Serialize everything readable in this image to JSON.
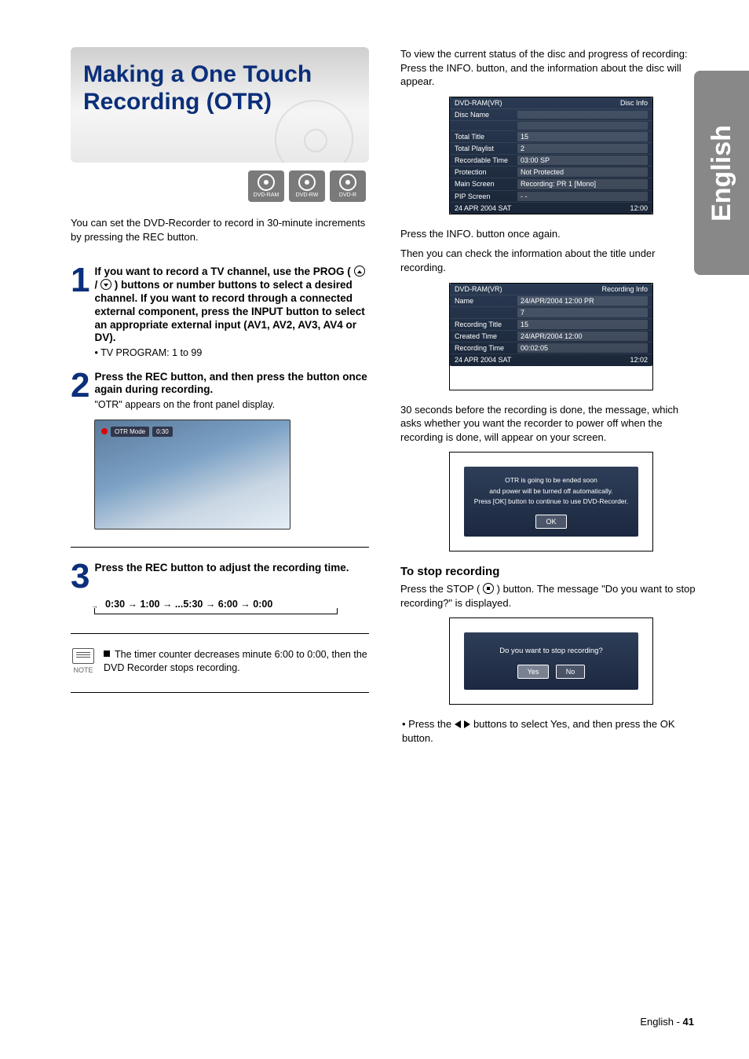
{
  "sideTab": "English",
  "title": "Making a One Touch Recording (OTR)",
  "badges": [
    "DVD-RAM",
    "DVD-RW",
    "DVD-R"
  ],
  "intro": "You can set the DVD-Recorder to record in 30-minute increments by pressing the REC button.",
  "steps": {
    "s1": {
      "num": "1",
      "body": "If you want to record a TV channel, use the PROG (        ) buttons or number buttons to select a desired channel. If you want to record through a connected external component, press the INPUT button to select an appropriate external input (AV1, AV2, AV3, AV4 or DV).",
      "sub": "• TV PROGRAM: 1 to 99"
    },
    "s2": {
      "num": "2",
      "body": "Press the REC button, and then press the button once again during recording.",
      "sub": "\"OTR\" appears on the front panel display."
    },
    "s3": {
      "num": "3",
      "body": "Press the REC button to adjust the recording time.",
      "seq": "0:30 → 1:00 → ...5:30 → 6:00 → 0:00"
    }
  },
  "otrOverlay": {
    "mode": "OTR Mode",
    "time": "0:30"
  },
  "noteLabel": "NOTE",
  "noteText": "The timer counter decreases minute 6:00 to 0:00, then the DVD Recorder stops recording.",
  "rightIntro": "To view the current status of the disc and progress of recording: Press the INFO. button, and the information about the disc will appear.",
  "panel1": {
    "head_l": "DVD-RAM(VR)",
    "head_r": "Disc Info",
    "rows": [
      {
        "lab": "Disc Name",
        "val": ""
      },
      {
        "lab": "",
        "val": ""
      },
      {
        "lab": "Total Title",
        "val": "15"
      },
      {
        "lab": "Total Playlist",
        "val": "2"
      },
      {
        "lab": "Recordable Time",
        "val": "03:00 SP"
      },
      {
        "lab": "Protection",
        "val": "Not Protected"
      },
      {
        "lab": "Main Screen",
        "val": "Recording: PR 1 [Mono]"
      },
      {
        "lab": "PIP Screen",
        "val": "- -"
      }
    ],
    "foot_l": "24 APR 2004 SAT",
    "foot_r": "12:00"
  },
  "midText1": "Press the INFO. button once again.",
  "midText2": "Then you can check the information about the title under recording.",
  "panel2": {
    "head_l": "DVD-RAM(VR)",
    "head_r": "Recording Info",
    "rows": [
      {
        "lab": "Name",
        "val": "24/APR/2004 12:00 PR"
      },
      {
        "lab": "",
        "val": "7"
      },
      {
        "lab": "Recording Title",
        "val": "15"
      },
      {
        "lab": "Created Time",
        "val": "24/APR/2004 12:00"
      },
      {
        "lab": "Recording Time",
        "val": "00:02:05"
      }
    ],
    "foot_l": "24 APR 2004 SAT",
    "foot_r": "12:02"
  },
  "para30": "30 seconds before the recording is done, the message, which asks whether you want the recorder to power off when the recording is done, will appear on your screen.",
  "msgPanel": {
    "l1": "OTR is going to be ended soon",
    "l2": "and power will be turned off automatically.",
    "l3": "Press [OK] button to continue to use DVD-Recorder.",
    "ok": "OK"
  },
  "stopHeading": "To stop recording",
  "stopText1": "Press the STOP (   ) button. The message \"Do you want to stop recording?\" is displayed.",
  "stopPanel": {
    "q": "Do you want to stop recording?",
    "yes": "Yes",
    "no": "No"
  },
  "stopBullet": "• Press the        buttons to select Yes, and then press the OK button.",
  "footerPrefix": "English - ",
  "footerPage": "41"
}
